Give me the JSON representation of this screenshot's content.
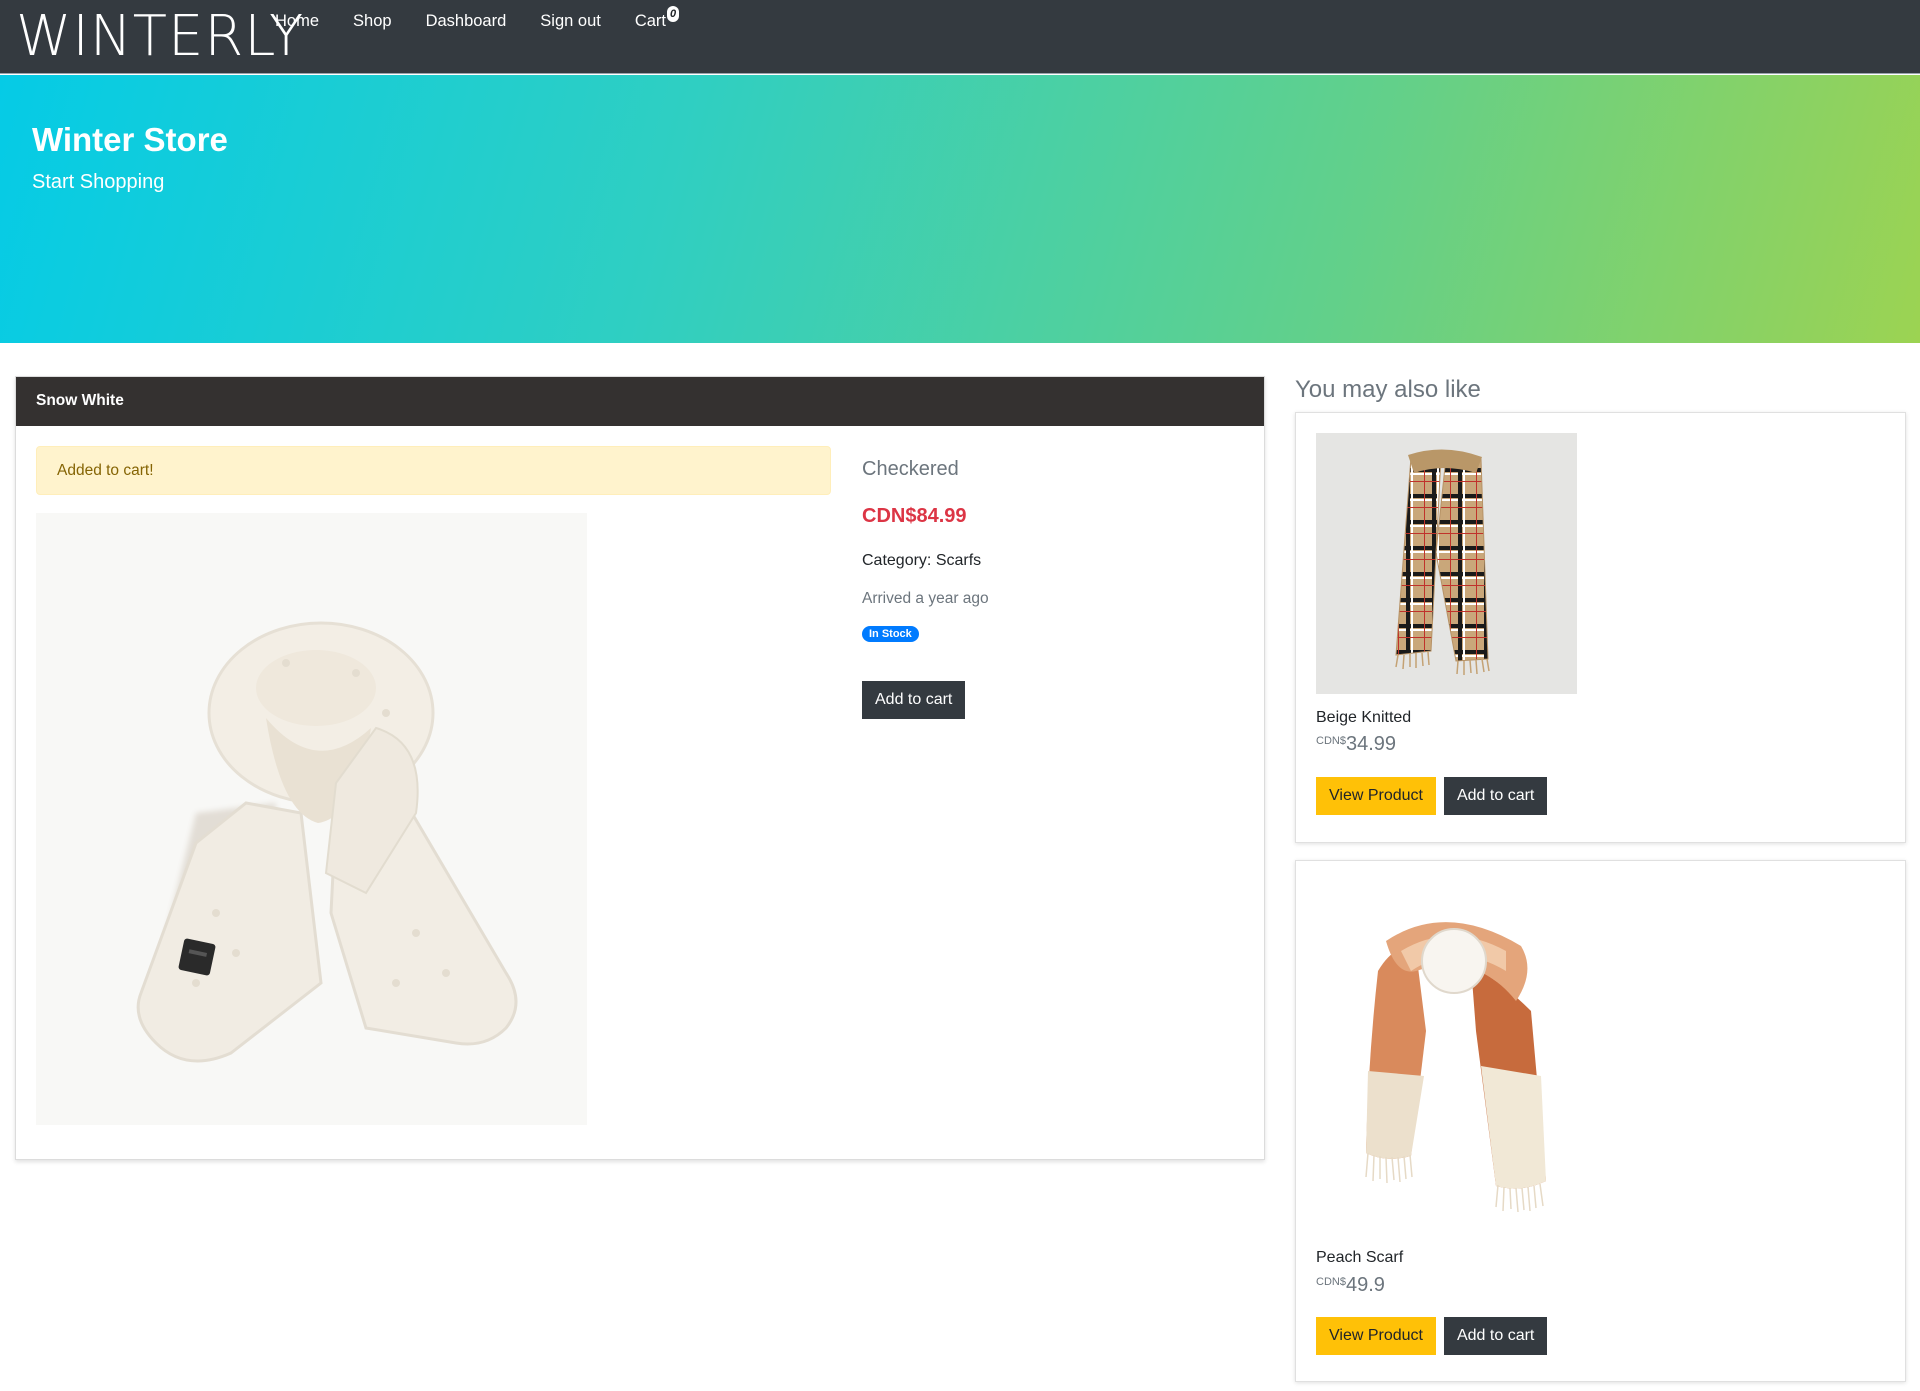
{
  "nav": {
    "brand": "WINTERLY",
    "links": [
      "Home",
      "Shop",
      "Dashboard",
      "Sign out",
      "Cart"
    ],
    "cart_count": "0"
  },
  "hero": {
    "title": "Winter Store",
    "subtitle": "Start Shopping"
  },
  "product": {
    "header": "Snow White",
    "alert": "Added to cart!",
    "name": "Checkered",
    "price": "CDN$84.99",
    "category": "Category: Scarfs",
    "arrived": "Arrived a year ago",
    "stock_badge": "In Stock",
    "add_to_cart": "Add to cart",
    "image_icon": "white-fleece-scarf"
  },
  "sidebar": {
    "title": "You may also like",
    "items": [
      {
        "name": "Beige Knitted",
        "currency": "CDN$",
        "price": "34.99",
        "view_label": "View Product",
        "cart_label": "Add to cart",
        "image_icon": "beige-check-scarf"
      },
      {
        "name": "Peach Scarf",
        "currency": "CDN$",
        "price": "49.9",
        "view_label": "View Product",
        "cart_label": "Add to cart",
        "image_icon": "peach-block-scarf"
      }
    ]
  },
  "colors": {
    "navbar": "#343a40",
    "price_red": "#dc3545",
    "badge_blue": "#007bff",
    "warning": "#ffc107",
    "alert_bg": "#fff3cd",
    "hero_start": "#05cbe6",
    "hero_end": "#9cd352"
  }
}
